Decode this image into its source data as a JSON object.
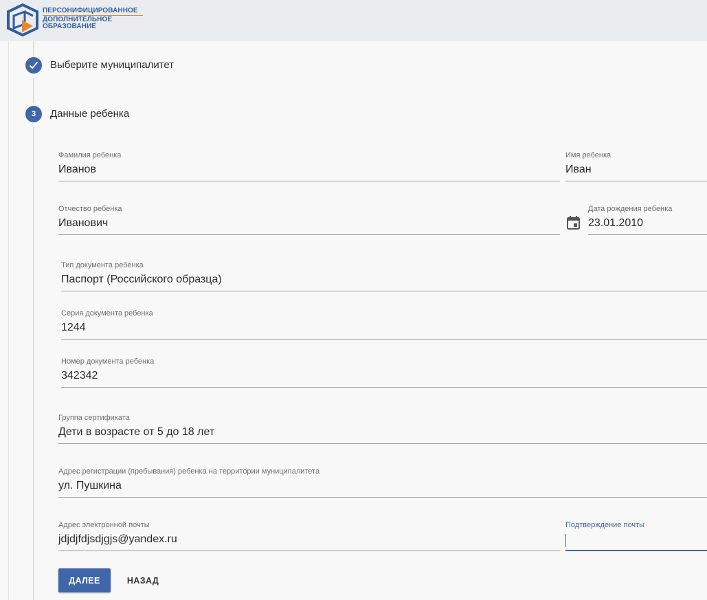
{
  "header": {
    "logo_lines": [
      "ПЕРСОНИФИЦИРОВАННОЕ",
      "ДОПОЛНИТЕЛЬНОЕ",
      "ОБРАЗОВАНИЕ"
    ],
    "logo_icon": "cube-logo-icon"
  },
  "steps": [
    {
      "status": "completed",
      "icon": "check-icon",
      "title": "Выберите муниципалитет"
    },
    {
      "status": "active",
      "number": "3",
      "title": "Данные ребенка"
    }
  ],
  "form": {
    "surname": {
      "label": "Фамилия ребенка",
      "value": "Иванов"
    },
    "name": {
      "label": "Имя ребенка",
      "value": "Иван"
    },
    "patronymic": {
      "label": "Отчество ребенка",
      "value": "Иванович"
    },
    "birth_date": {
      "label": "Дата рождения ребенка",
      "value": "23.01.2010",
      "icon": "calendar-icon"
    },
    "doc_type": {
      "label": "Тип документа ребенка",
      "value": "Паспорт (Российского образца)"
    },
    "doc_series": {
      "label": "Серия документа ребенка",
      "value": "1244"
    },
    "doc_number": {
      "label": "Номер документа ребенка",
      "value": "342342"
    },
    "cert_group": {
      "label": "Группа сертификата",
      "value": "Дети в возрасте от 5 до 18 лет"
    },
    "address": {
      "label": "Адрес регистрации (пребывания) ребенка на территории муниципалитета",
      "value": "ул. Пушкина"
    },
    "email": {
      "label": "Адрес электронной почты",
      "value": "jdjdjfdjsdjgjs@yandex.ru"
    },
    "email_confirm": {
      "label": "Подтверждение почты",
      "value": ""
    }
  },
  "buttons": {
    "next": "ДАЛЕЕ",
    "back": "НАЗАД"
  },
  "colors": {
    "accent": "#3f66a8",
    "logo_orange": "#e58a2c",
    "header_bg": "#ebecef"
  }
}
